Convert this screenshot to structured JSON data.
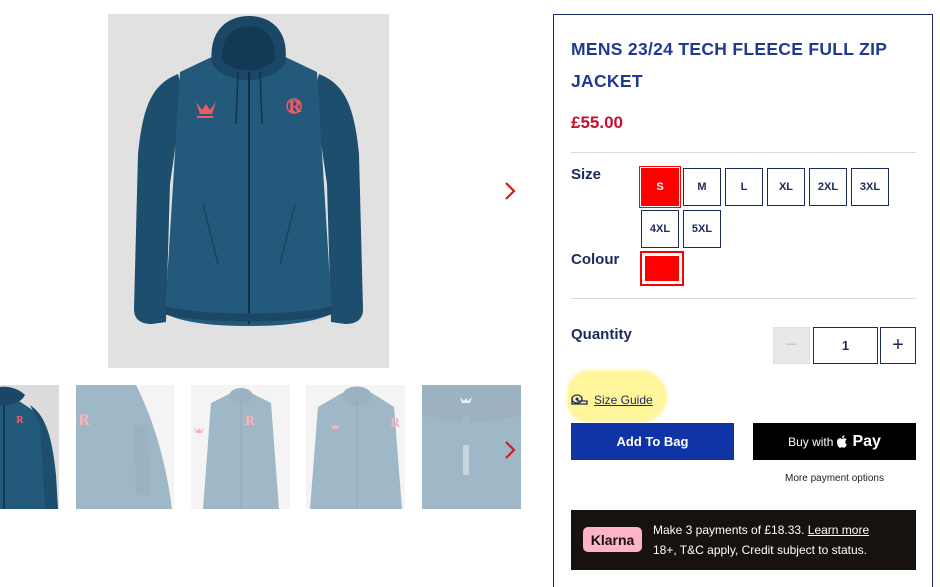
{
  "product": {
    "title": "MENS 23/24 TECH FLEECE FULL ZIP JACKET",
    "price": "£55.00"
  },
  "gallery": {
    "main_image": "jacket-front-image",
    "next_icon": "chevron-right-icon",
    "thumbnails": [
      "jacket-front",
      "jacket-side-detail",
      "jacket-front-faded",
      "jacket-front-faded-2",
      "jacket-hood-detail"
    ]
  },
  "size": {
    "label": "Size",
    "options": [
      "S",
      "M",
      "L",
      "XL",
      "2XL",
      "3XL",
      "4XL",
      "5XL"
    ],
    "selected": "S"
  },
  "colour": {
    "label": "Colour",
    "selected_hex": "#ff0000"
  },
  "quantity": {
    "label": "Quantity",
    "value": "1",
    "minus": "−",
    "plus": "+"
  },
  "size_guide": {
    "label": "Size Guide",
    "icon": "tape-measure-icon"
  },
  "actions": {
    "add_to_bag": "Add To Bag",
    "buy_with": "Buy with",
    "apple_pay": " Pay",
    "more_payment": "More payment options"
  },
  "klarna": {
    "badge": "Klarna",
    "line1_text": "Make 3 payments of £18.33.",
    "learn_more": "Learn more",
    "line2": "18+, T&C apply, Credit subject to status."
  },
  "colors": {
    "brand_blue": "#1034a6",
    "price_red": "#c8102e",
    "navy": "#1c2a5a",
    "jacket": "#1d4e6e",
    "klarna_pink": "#ffb3c7"
  }
}
